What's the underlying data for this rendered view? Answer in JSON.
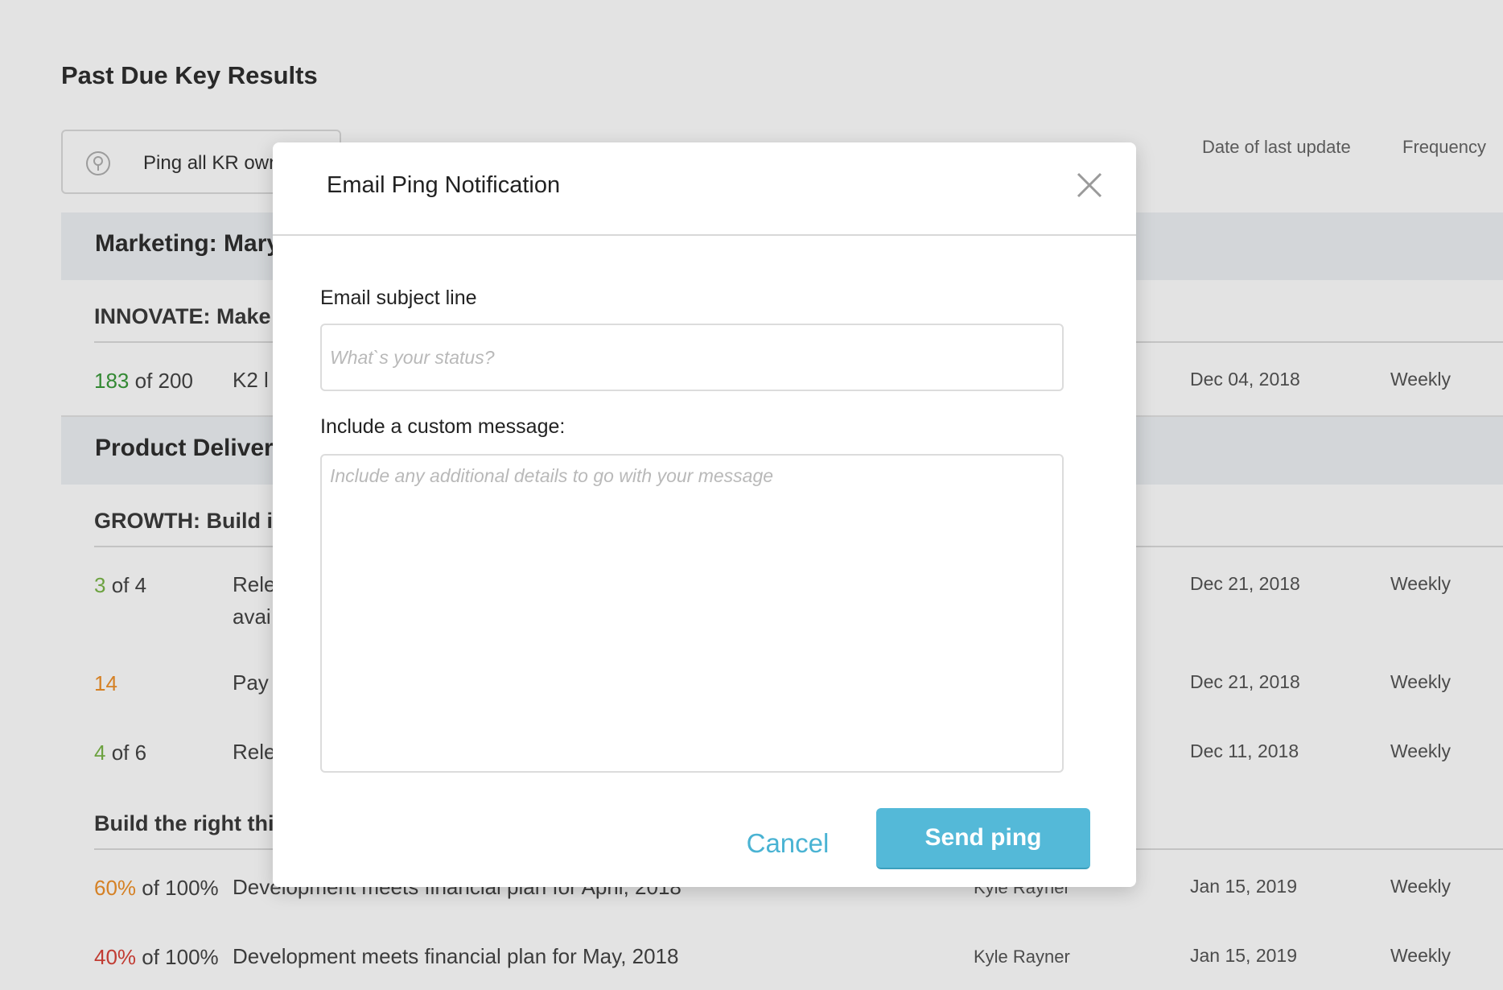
{
  "page": {
    "title": "Past Due Key Results",
    "ping_all_label": "Ping all KR owners",
    "columns": {
      "last_update": "Date of last update",
      "frequency": "Frequency"
    }
  },
  "groups": [
    {
      "name": "Marketing: Mary",
      "objectives": [
        {
          "title": "INNOVATE: Make",
          "rows": [
            {
              "progress_value": "183",
              "progress_rest": " of 200",
              "progress_color": "#3a9a3a",
              "title": "K2 l",
              "title_line2": "",
              "owner": "",
              "date": "Dec 04, 2018",
              "frequency": "Weekly"
            }
          ]
        }
      ]
    },
    {
      "name": "Product Delivery",
      "objectives": [
        {
          "title": "GROWTH: Build i",
          "rows": [
            {
              "progress_value": "3",
              "progress_rest": " of 4",
              "progress_color": "#7ab648",
              "title": "Rele",
              "title_line2": "avai",
              "owner": "",
              "date": "Dec 21, 2018",
              "frequency": "Weekly"
            },
            {
              "progress_value": "14",
              "progress_rest": "",
              "progress_color": "#f0912a",
              "title": "Pay",
              "title_line2": "",
              "owner": "",
              "date": "Dec 21, 2018",
              "frequency": "Weekly"
            },
            {
              "progress_value": "4",
              "progress_rest": " of 6",
              "progress_color": "#7ab648",
              "title": "Rele",
              "title_line2": "",
              "owner": "",
              "date": "Dec 11, 2018",
              "frequency": "Weekly"
            }
          ]
        },
        {
          "title": "Build the right thi",
          "rows": [
            {
              "progress_value": "60%",
              "progress_rest": " of 100%",
              "progress_color": "#f0912a",
              "title": "Development meets financial plan for April, 2018",
              "title_line2": "",
              "owner": "Kyle Rayner",
              "date": "Jan 15, 2019",
              "frequency": "Weekly"
            },
            {
              "progress_value": "40%",
              "progress_rest": " of 100%",
              "progress_color": "#d9443a",
              "title": "Development meets financial plan for May, 2018",
              "title_line2": "",
              "owner": "Kyle Rayner",
              "date": "Jan 15, 2019",
              "frequency": "Weekly"
            }
          ]
        }
      ]
    }
  ],
  "modal": {
    "title": "Email Ping Notification",
    "close_icon": "close-icon",
    "subject_label": "Email subject line",
    "subject_value": "",
    "subject_placeholder": "What`s your status?",
    "message_label": "Include a custom message:",
    "message_value": "",
    "message_placeholder": "Include any additional details to go with your message",
    "cancel_label": "Cancel",
    "send_label": "Send ping"
  },
  "colors": {
    "accent": "#54b9d8",
    "link": "#4ab3d3",
    "progress_green": "#3a9a3a",
    "progress_light_green": "#7ab648",
    "progress_orange": "#f0912a",
    "progress_red": "#d9443a"
  }
}
